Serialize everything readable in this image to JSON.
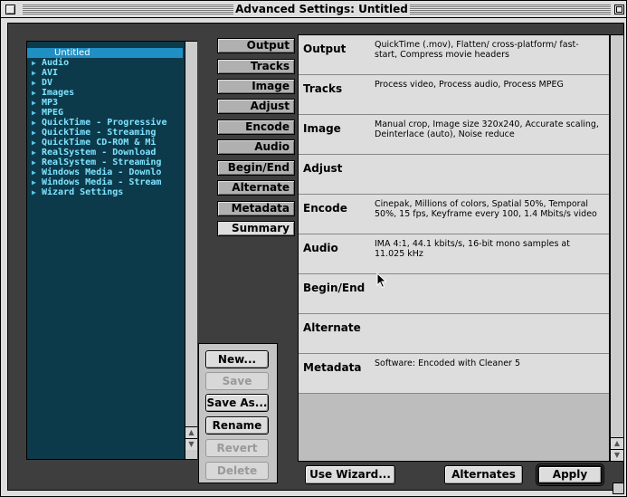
{
  "window": {
    "title": "Advanced Settings: Untitled"
  },
  "settings_list": {
    "items": [
      {
        "label": "Untitled",
        "selected": true,
        "has_disclosure": false
      },
      {
        "label": "Audio",
        "has_disclosure": true
      },
      {
        "label": "AVI",
        "has_disclosure": true
      },
      {
        "label": "DV",
        "has_disclosure": true
      },
      {
        "label": "Images",
        "has_disclosure": true
      },
      {
        "label": "MP3",
        "has_disclosure": true
      },
      {
        "label": "MPEG",
        "has_disclosure": true
      },
      {
        "label": "QuickTime - Progressive",
        "has_disclosure": true
      },
      {
        "label": "QuickTime - Streaming",
        "has_disclosure": true
      },
      {
        "label": "QuickTime CD-ROM & Mi",
        "has_disclosure": true
      },
      {
        "label": "RealSystem - Download",
        "has_disclosure": true
      },
      {
        "label": "RealSystem - Streaming",
        "has_disclosure": true
      },
      {
        "label": "Windows Media - Downlo",
        "has_disclosure": true
      },
      {
        "label": "Windows Media - Stream",
        "has_disclosure": true
      },
      {
        "label": "Wizard Settings",
        "has_disclosure": true
      }
    ]
  },
  "tabs": [
    {
      "label": "Output"
    },
    {
      "label": "Tracks"
    },
    {
      "label": "Image"
    },
    {
      "label": "Adjust"
    },
    {
      "label": "Encode"
    },
    {
      "label": "Audio"
    },
    {
      "label": "Begin/End"
    },
    {
      "label": "Alternate"
    },
    {
      "label": "Metadata"
    },
    {
      "label": "Summary",
      "active": true
    }
  ],
  "panel_buttons": {
    "new": "New...",
    "save": "Save",
    "save_as": "Save As...",
    "rename": "Rename",
    "revert": "Revert",
    "delete": "Delete"
  },
  "summary": {
    "rows": [
      {
        "label": "Output",
        "value": "QuickTime (.mov), Flatten/ cross-platform/ fast-start, Compress movie headers"
      },
      {
        "label": "Tracks",
        "value": "Process video, Process audio, Process MPEG"
      },
      {
        "label": "Image",
        "value": "Manual crop, Image size 320x240, Accurate scaling, Deinterlace (auto), Noise reduce"
      },
      {
        "label": "Adjust",
        "value": ""
      },
      {
        "label": "Encode",
        "value": "Cinepak, Millions of colors, Spatial 50%, Temporal 50%, 15 fps, Keyframe every 100, 1.4 Mbits/s video"
      },
      {
        "label": "Audio",
        "value": "IMA 4:1, 44.1 kbits/s, 16-bit mono samples at 11.025 kHz"
      },
      {
        "label": "Begin/End",
        "value": ""
      },
      {
        "label": "Alternate",
        "value": ""
      },
      {
        "label": "Metadata",
        "value": "Software: Encoded with Cleaner 5"
      }
    ]
  },
  "bottom_buttons": {
    "use_wizard": "Use Wizard...",
    "alternates": "Alternates",
    "apply": "Apply"
  },
  "icons": {
    "disclosure": "disclosure-triangle-icon",
    "close": "close-box-icon",
    "zoom": "zoom-box-icon",
    "cursor": "arrow-cursor-icon"
  },
  "colors": {
    "list_background": "#0d3a4b",
    "list_text": "#7ee3ff",
    "list_selection": "#1f8fc4",
    "body_dark": "#3e3e3e",
    "tab_inactive": "#b0b0b0",
    "tab_active": "#dddddd"
  }
}
